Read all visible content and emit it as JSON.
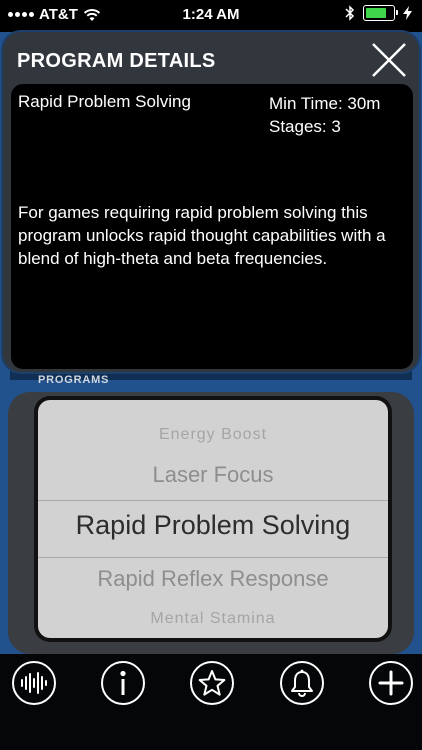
{
  "status_bar": {
    "carrier": "AT&T",
    "time": "1:24 AM",
    "battery_level": 0.85
  },
  "modal": {
    "title": "PROGRAM DETAILS",
    "program": {
      "name": "Rapid Problem Solving",
      "min_time": "Min Time: 30m",
      "stages": "Stages: 3",
      "description": "For games requiring rapid problem solving this program unlocks rapid thought capabilities with a blend of high-theta and beta frequencies."
    }
  },
  "programs": {
    "label": "PROGRAMS",
    "items": [
      "Energy Boost",
      "Laser Focus",
      "Rapid Problem Solving",
      "Rapid Reflex Response",
      "Mental Stamina"
    ],
    "selected": "Rapid Problem Solving"
  },
  "toolbar": {
    "buttons": [
      "waveform-icon",
      "info-icon",
      "star-icon",
      "bell-icon",
      "plus-icon"
    ]
  },
  "colors": {
    "frame_blue": "#22528e",
    "modal_gray": "#32373e",
    "picker_bg": "#d2d2d2",
    "battery_green": "#3fd64b"
  }
}
